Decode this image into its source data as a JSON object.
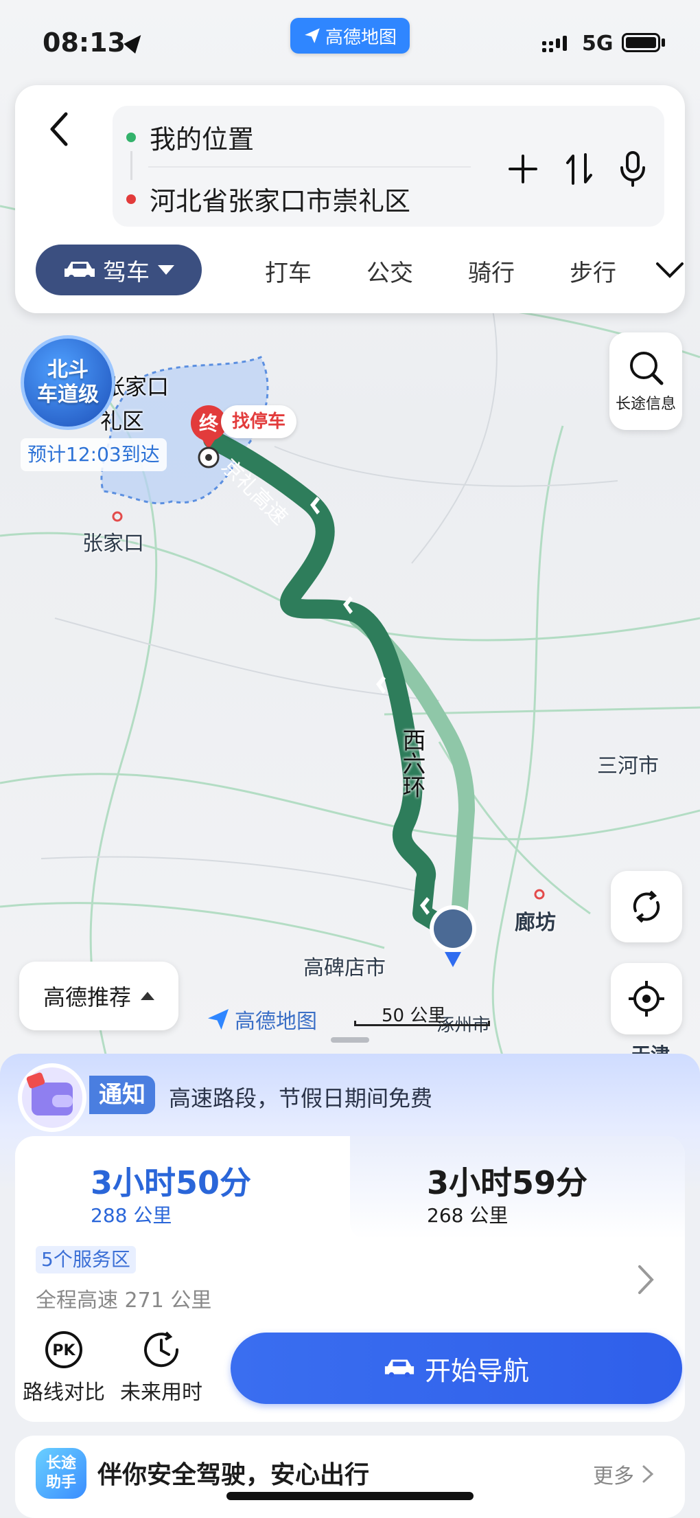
{
  "status": {
    "time": "08:13",
    "network": "5G",
    "app_badge": "高德地图"
  },
  "search": {
    "origin": "我的位置",
    "destination": "河北省张家口市崇礼区",
    "origin_color": "#33b26b",
    "destination_color": "#e23b3b"
  },
  "modes": {
    "active": "驾车",
    "items": [
      "打车",
      "公交",
      "骑行",
      "步行"
    ]
  },
  "map": {
    "beidou_line1": "北斗",
    "beidou_line2": "车道级",
    "dest_area_name": "张家口",
    "dest_area_name2": "礼区",
    "eta": "预计12:03到达",
    "dest_pin": "终",
    "parking": "找停车",
    "long_trip_info": "长途信息",
    "road_names": [
      "京礼高速",
      "西六环"
    ],
    "places": [
      "张家口",
      "三河市",
      "廊坊",
      "高碑店市",
      "涿州市",
      "天津"
    ],
    "recommend": "高德推荐",
    "watermark": "高德地图",
    "scale": "50 公里",
    "route_color": "#2e7d5b",
    "alt_route_color": "#8fc7a8"
  },
  "notice": {
    "tag": "通知",
    "text": "高速路段，节假日期间免费"
  },
  "routes": [
    {
      "time": "3小时50分",
      "distance": "288 公里"
    },
    {
      "time": "3小时59分",
      "distance": "268 公里"
    }
  ],
  "route_detail": {
    "service_areas": "5个服务区",
    "highway": "全程高速 271 公里"
  },
  "actions": {
    "compare": "路线对比",
    "future": "未来用时",
    "start": "开始导航"
  },
  "assistant": {
    "icon_line1": "长途",
    "icon_line2": "助手",
    "text": "伴你安全驾驶，安心出行",
    "more": "更多"
  }
}
